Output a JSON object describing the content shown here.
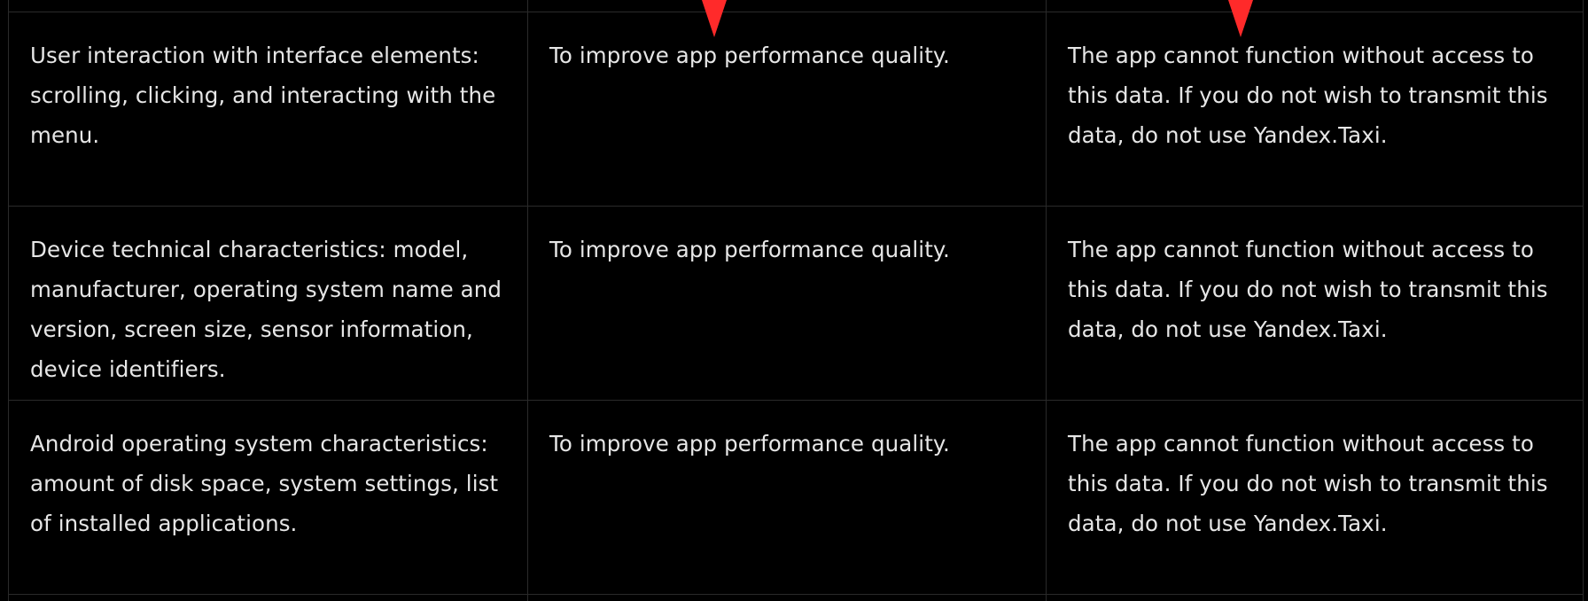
{
  "rows": [
    {
      "data_type": "User interaction with interface elements: scrolling, clicking, and interacting with the menu.",
      "purpose": "To improve app performance quality.",
      "consequence": "The app cannot function without access to this data. If you do not wish to transmit this data, do not use Yandex.Taxi."
    },
    {
      "data_type": "Device technical characteristics: model, manufacturer, operating system name and version, screen size, sensor information, device identifiers.",
      "purpose": "To improve app performance quality.",
      "consequence": "The app cannot function without access to this data. If you do not wish to transmit this data, do not use Yandex.Taxi."
    },
    {
      "data_type": "Android operating system characteristics: amount of disk space, system settings, list of installed applications.",
      "purpose": "To improve app performance quality.",
      "consequence": "The app cannot function without access to this data. If you do not wish to transmit this data, do not use Yandex.Taxi."
    }
  ],
  "annotations": {
    "arrow_color": "#ff2a2a",
    "arrows": [
      "down-arrow-marker",
      "down-arrow-marker"
    ]
  },
  "colors": {
    "background": "#000000",
    "text": "#e6e6e6",
    "border": "#2a2a2a"
  }
}
